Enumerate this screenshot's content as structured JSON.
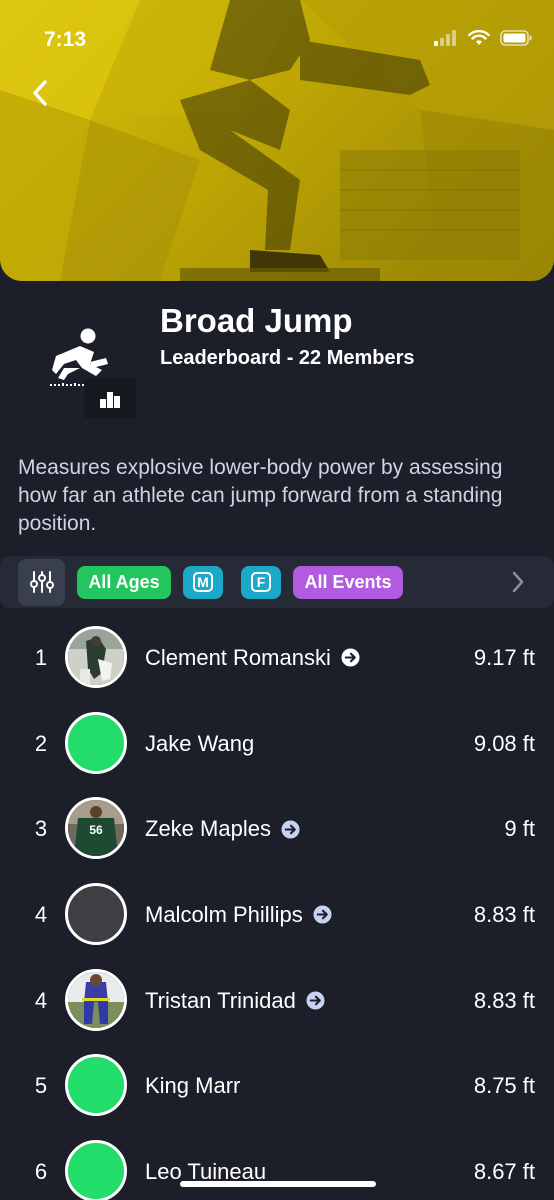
{
  "status_bar": {
    "time": "7:13",
    "icons": [
      "signal-icon",
      "wifi-icon",
      "battery-icon"
    ]
  },
  "header": {
    "back_icon": "chevron-left-icon",
    "hero_tint": "#d4bb08"
  },
  "event": {
    "title": "Broad Jump",
    "subtitle": "Leaderboard - 22 Members",
    "icon": "broad-jump-icon",
    "badge_icon": "podium-icon",
    "description": "Measures explosive lower-body power by assessing how far an athlete can jump forward from a standing position."
  },
  "filters": {
    "settings_icon": "sliders-icon",
    "chips": [
      {
        "label": "All Ages",
        "color": "#22c55e"
      },
      {
        "label": "M",
        "color": "#1ba8c9"
      },
      {
        "label": "F",
        "color": "#1ba8c9"
      },
      {
        "label": "All Events",
        "color": "#b05be0"
      }
    ],
    "scroll_icon": "chevron-right-icon"
  },
  "leaderboard": [
    {
      "rank": "1",
      "name": "Clement Romanski",
      "score": "9.17 ft",
      "has_link": true,
      "link_style": "white",
      "avatar": "photo"
    },
    {
      "rank": "2",
      "name": "Jake Wang",
      "score": "9.08 ft",
      "has_link": false,
      "avatar": "green"
    },
    {
      "rank": "3",
      "name": "Zeke Maples",
      "score": "9 ft",
      "has_link": true,
      "link_style": "blue",
      "avatar": "photo"
    },
    {
      "rank": "4",
      "name": "Malcolm Phillips",
      "score": "8.83 ft",
      "has_link": true,
      "link_style": "blue",
      "avatar": "gray"
    },
    {
      "rank": "4",
      "name": "Tristan Trinidad",
      "score": "8.83 ft",
      "has_link": true,
      "link_style": "blue",
      "avatar": "photo"
    },
    {
      "rank": "5",
      "name": "King Marr",
      "score": "8.75 ft",
      "has_link": false,
      "avatar": "green"
    },
    {
      "rank": "6",
      "name": "Leo Tuineau",
      "score": "8.67 ft",
      "has_link": false,
      "avatar": "green"
    }
  ],
  "colors": {
    "background": "#1c1f29",
    "avatar_green": "#22dd6a",
    "link_blue": "#c5d3f0"
  }
}
